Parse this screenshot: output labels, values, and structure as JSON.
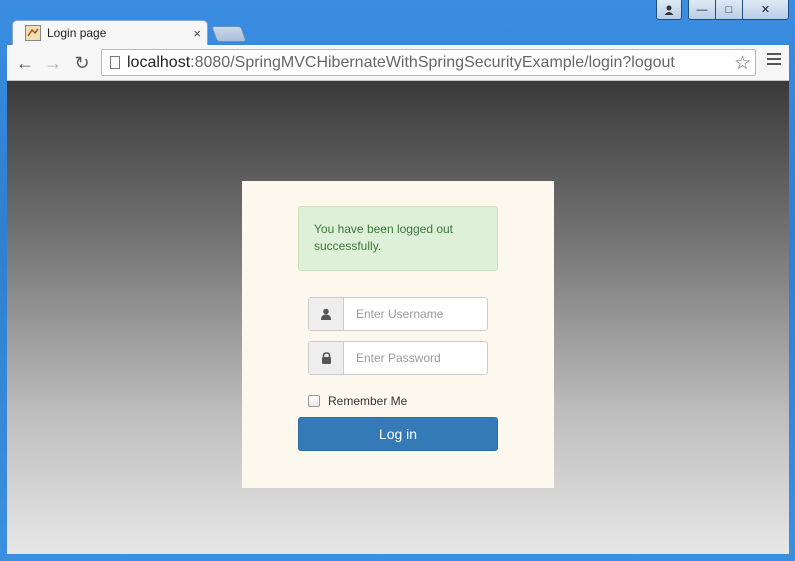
{
  "browser": {
    "tab_title": "Login page",
    "tab_close": "×",
    "favicon": "tomcat-icon",
    "url_host": "localhost",
    "url_rest": ":8080/SpringMVCHibernateWithSpringSecurityExample/login?logout",
    "star": "☆",
    "back": "←",
    "forward": "→",
    "reload": "↻"
  },
  "window_controls": {
    "minimize": "—",
    "maximize": "□",
    "close": "✕"
  },
  "login": {
    "alert_text": "You have been logged out successfully.",
    "username_placeholder": "Enter Username",
    "password_placeholder": "Enter Password",
    "remember_label": "Remember Me",
    "submit_label": "Log in",
    "colors": {
      "card_bg": "#fdf8ee",
      "alert_bg": "#dff0d8",
      "alert_text": "#3c763d",
      "button_bg": "#337ab7"
    }
  }
}
